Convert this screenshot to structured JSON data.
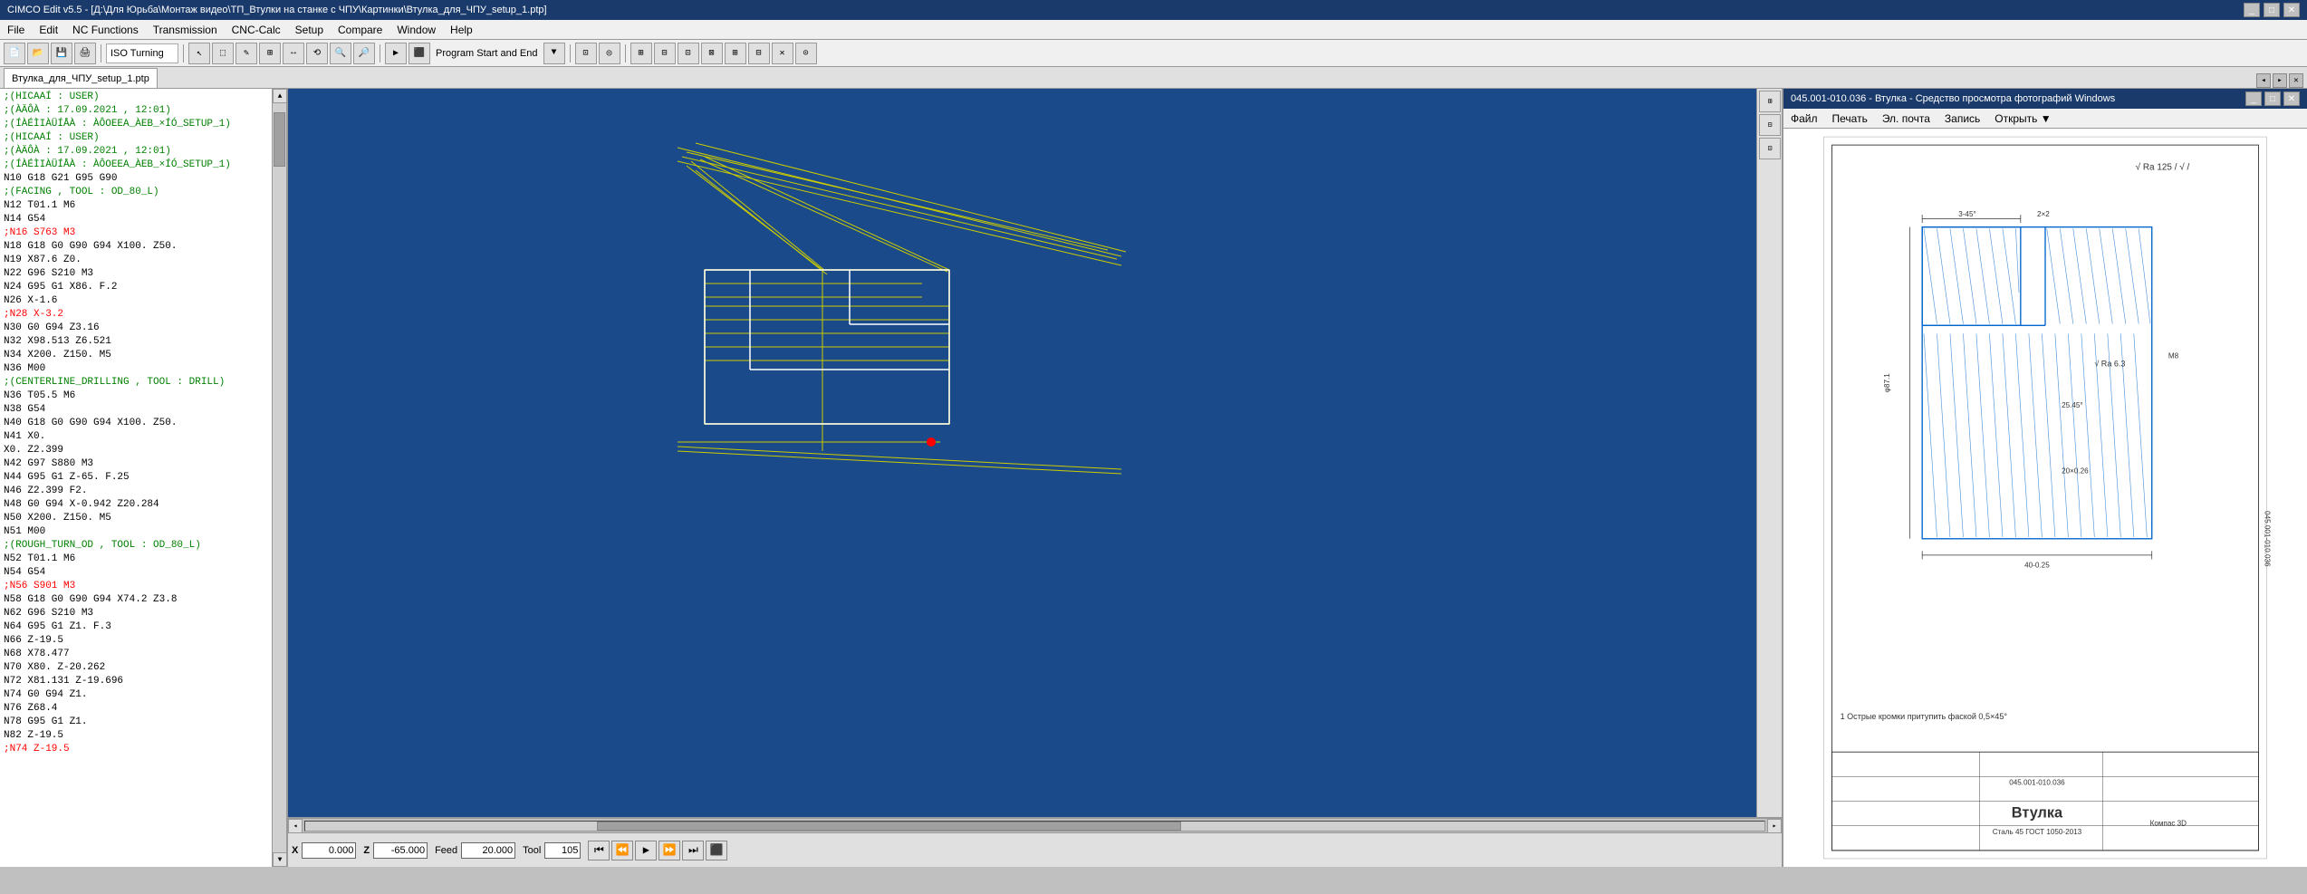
{
  "app": {
    "title": "CIMCO Edit v5.5 - [Д:\\Для Юрьба\\Монтаж видео\\ТП_Втулки на станке с ЧПУ\\Картинки\\Втулка_для_ЧПУ_setup_1.ptp]",
    "image_viewer_title": "045.001-010.036 - Втулка - Средство просмотра фотографий Windows"
  },
  "menus": {
    "main": [
      "File",
      "Edit",
      "NC Functions",
      "Transmission",
      "CNC-Calc",
      "Setup",
      "Compare",
      "Window",
      "Help"
    ],
    "image": [
      "Файл",
      "Печать",
      "Эл. почта",
      "Запись",
      "Открыть ▼"
    ]
  },
  "toolbar": {
    "iso_turning_label": "ISO Turning"
  },
  "tab": {
    "label": "Втулка_для_ЧПУ_setup_1.ptp"
  },
  "code_lines": [
    {
      "text": ";(НICAAÍ        : USER)",
      "color": "green"
    },
    {
      "text": ";(ÀÄÔÀ         : 17.09.2021 , 12:01)",
      "color": "green"
    },
    {
      "text": ";(ÍÀÉÌIÀÜÍÅÀ    : ÀÔOEEA_ÀEB_×ÍÓ_SETUP_1)",
      "color": "green"
    },
    {
      "text": ";(НICAAÍ        : USER)",
      "color": "green"
    },
    {
      "text": ";(ÀÄÔÀ         : 17.09.2021 , 12:01)",
      "color": "green"
    },
    {
      "text": ";(ÍÀÉÌIÀÜÍÅÀ    : ÀÔOEEA_ÀEB_×ÍÓ_SETUP_1)",
      "color": "green"
    },
    {
      "text": "N10 G18 G21 G95 G90",
      "color": "default"
    },
    {
      "text": ";(FACING , TOOL : OD_80_L)",
      "color": "green"
    },
    {
      "text": "N12 T01.1 M6",
      "color": "default"
    },
    {
      "text": "N14 G54",
      "color": "default"
    },
    {
      "text": ";N16 S763 M3",
      "color": "red"
    },
    {
      "text": "N18 G18 G0 G90 G94 X100. Z50.",
      "color": "default"
    },
    {
      "text": "N19 X87.6 Z0.",
      "color": "default"
    },
    {
      "text": "N22 G96 S210 M3",
      "color": "default"
    },
    {
      "text": "N24 G95 G1 X86. F.2",
      "color": "default"
    },
    {
      "text": "N26 X-1.6",
      "color": "default"
    },
    {
      "text": ";N28 X-3.2",
      "color": "red"
    },
    {
      "text": "N30 G0 G94 Z3.16",
      "color": "default"
    },
    {
      "text": "N32 X98.513 Z6.521",
      "color": "default"
    },
    {
      "text": "N34 X200. Z150. M5",
      "color": "default"
    },
    {
      "text": "N36 M00",
      "color": "default"
    },
    {
      "text": ";(CENTERLINE_DRILLING , TOOL : DRILL)",
      "color": "green"
    },
    {
      "text": "N36 T05.5 M6",
      "color": "default"
    },
    {
      "text": "N38 G54",
      "color": "default"
    },
    {
      "text": "N40 G18 G0 G90 G94 X100. Z50.",
      "color": "default"
    },
    {
      "text": "N41 X0.",
      "color": "default"
    },
    {
      "text": "X0. Z2.399",
      "color": "default"
    },
    {
      "text": "N42 G97 S880 M3",
      "color": "default"
    },
    {
      "text": "N44 G95 G1 Z-65. F.25",
      "color": "default"
    },
    {
      "text": "N46 Z2.399 F2.",
      "color": "default"
    },
    {
      "text": "N48 G0 G94 X-0.942 Z20.284",
      "color": "default"
    },
    {
      "text": "N50 X200. Z150. M5",
      "color": "default"
    },
    {
      "text": "N51 M00",
      "color": "default"
    },
    {
      "text": ";(ROUGH_TURN_OD , TOOL : OD_80_L)",
      "color": "green"
    },
    {
      "text": "N52 T01.1 M6",
      "color": "default"
    },
    {
      "text": "N54 G54",
      "color": "default"
    },
    {
      "text": ";N56 S901 M3",
      "color": "red"
    },
    {
      "text": "N58 G18 G0 G90 G94 X74.2 Z3.8",
      "color": "default"
    },
    {
      "text": "N62 G96 S210 M3",
      "color": "default"
    },
    {
      "text": "N64 G95 G1 Z1. F.3",
      "color": "default"
    },
    {
      "text": "N66 Z-19.5",
      "color": "default"
    },
    {
      "text": "N68 X78.477",
      "color": "default"
    },
    {
      "text": "N70 X80. Z-20.262",
      "color": "default"
    },
    {
      "text": "N72 X81.131 Z-19.696",
      "color": "default"
    },
    {
      "text": "N74 G0 G94 Z1.",
      "color": "default"
    },
    {
      "text": "N76 Z68.4",
      "color": "default"
    },
    {
      "text": "N78 G95 G1 Z1.",
      "color": "default"
    },
    {
      "text": "N82 Z-19.5",
      "color": "default"
    },
    {
      "text": ";N74 Z-19.5",
      "color": "red"
    }
  ],
  "vis_controls": {
    "x_label": "X",
    "x_value": "0.000",
    "z_label": "Z",
    "z_value": "-65.000",
    "feed_label": "Feed",
    "feed_value": "20.000",
    "tool_label": "Tool",
    "tool_value": "105"
  },
  "drawing": {
    "title": "Втулка",
    "doc_number": "045.001-010.036",
    "material": "Сталь 45 ГОСТ 1050-2013",
    "scale": "Компас 3D",
    "note": "1 Острые кромки притупить фаской 0,5×45°"
  }
}
